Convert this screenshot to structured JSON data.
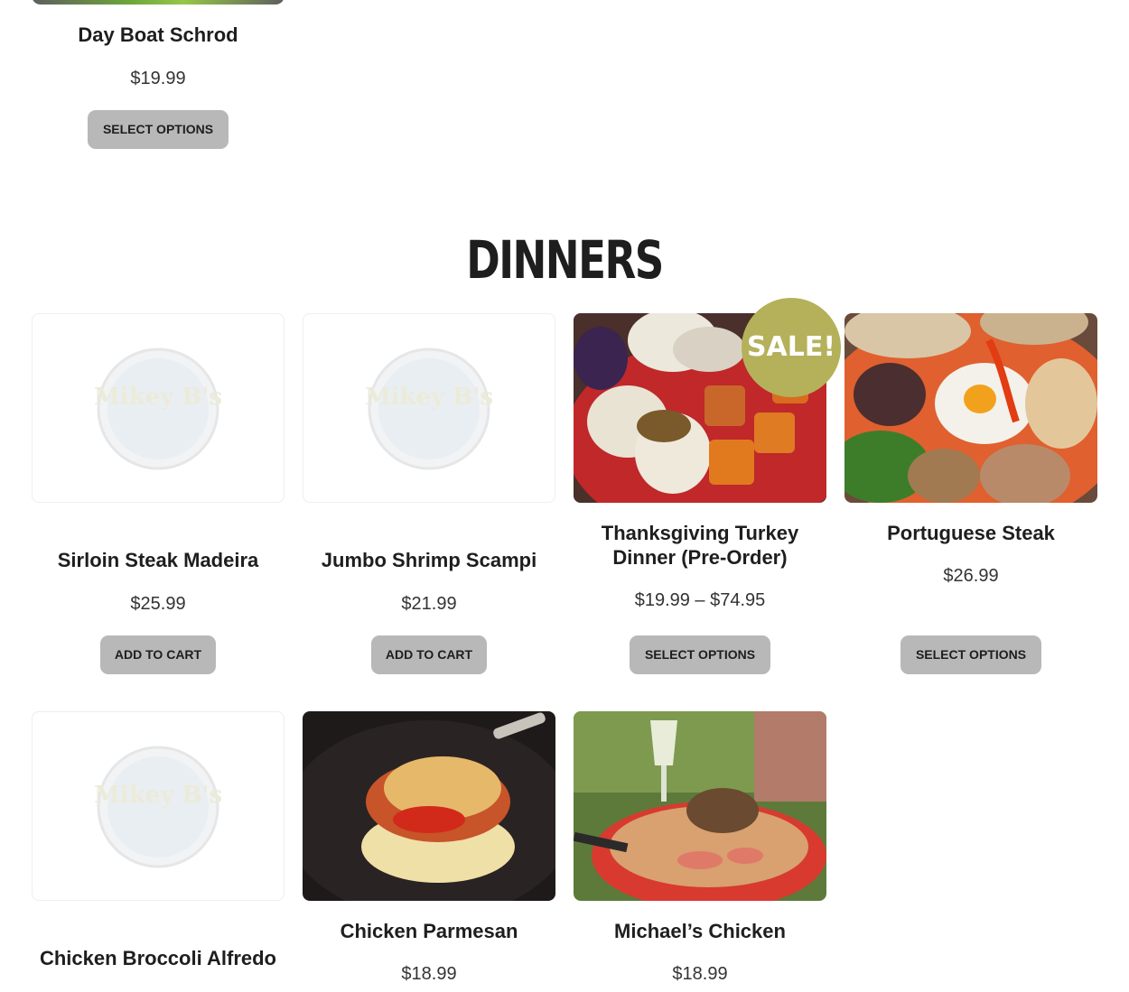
{
  "top_product": {
    "name": "Day Boat Schrod",
    "price": "$19.99",
    "button": "SELECT OPTIONS"
  },
  "section": {
    "title": "DINNERS"
  },
  "logo_text": "Mikey B's",
  "sale_badge": "SALE!",
  "products": [
    {
      "name": "Sirloin Steak Madeira",
      "price": "$25.99",
      "button": "ADD TO CART",
      "image": "placeholder-logo"
    },
    {
      "name": "Jumbo Shrimp Scampi",
      "price": "$21.99",
      "button": "ADD TO CART",
      "image": "placeholder-logo"
    },
    {
      "name": "Thanksgiving Turkey Dinner (Pre-Order)",
      "price": "$19.99 – $74.95",
      "button": "SELECT OPTIONS",
      "image": "turkey-dinner-photo",
      "on_sale": true
    },
    {
      "name": "Portuguese Steak",
      "price": "$26.99",
      "button": "SELECT OPTIONS",
      "image": "portuguese-steak-photo"
    },
    {
      "name": "Chicken Broccoli Alfredo",
      "price": "",
      "button": "",
      "image": "placeholder-logo"
    },
    {
      "name": "Chicken Parmesan",
      "price": "$18.99",
      "button": "",
      "image": "chicken-parmesan-photo"
    },
    {
      "name": "Michael’s Chicken",
      "price": "$18.99",
      "button": "",
      "image": "michaels-chicken-photo"
    }
  ],
  "colors": {
    "button_bg": "#b8b8b8",
    "sale_badge": "#b4b15a",
    "text": "#1e1e1e"
  }
}
